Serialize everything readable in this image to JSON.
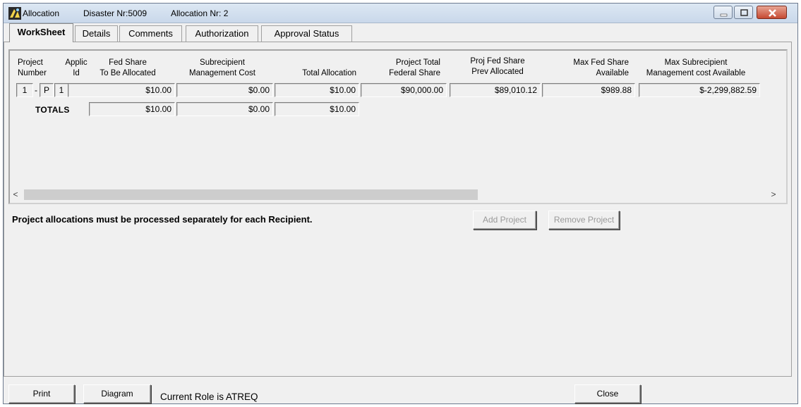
{
  "window": {
    "title_app": "Allocation",
    "title_disaster": "Disaster Nr:5009",
    "title_allocation": "Allocation Nr: 2"
  },
  "tabs": [
    {
      "label": "WorkSheet",
      "active": true
    },
    {
      "label": "Details",
      "active": false
    },
    {
      "label": "Comments",
      "active": false
    },
    {
      "label": "Authorization",
      "active": false
    },
    {
      "label": "Approval Status",
      "active": false
    }
  ],
  "grid": {
    "headers": {
      "project_number": [
        "Project",
        "Number"
      ],
      "applic_id": [
        "Applic",
        "Id"
      ],
      "fed_share": [
        "Fed Share",
        "To Be Allocated"
      ],
      "subrecipient_mgmt": [
        "Subrecipient",
        "Management Cost"
      ],
      "total_allocation": "Total Allocation",
      "project_total_fed": [
        "Project Total",
        "Federal Share"
      ],
      "proj_fed_prev": [
        "Proj Fed Share",
        "Prev Allocated"
      ],
      "max_fed_available": [
        "Max Fed Share",
        "Available"
      ],
      "max_subrecipient": [
        "Max Subrecipient",
        "Management cost Available"
      ]
    },
    "row": {
      "project_number": "1",
      "separator": "-",
      "applic_prefix": "P",
      "applic_id": "1",
      "fed_share": "$10.00",
      "subrecipient_mgmt": "$0.00",
      "total_allocation": "$10.00",
      "project_total_fed": "$90,000.00",
      "proj_fed_prev": "$89,010.12",
      "max_fed_available": "$989.88",
      "max_subrecipient": "$-2,299,882.59"
    },
    "totals": {
      "label": "TOTALS",
      "fed_share": "$10.00",
      "subrecipient_mgmt": "$0.00",
      "total_allocation": "$10.00"
    },
    "scroll_left": "<",
    "scroll_right": ">"
  },
  "notice": "Project allocations must be processed separately for each Recipient.",
  "buttons": {
    "add_project": "Add Project",
    "remove_project": "Remove Project",
    "print": "Print",
    "diagram": "Diagram",
    "close": "Close"
  },
  "status": {
    "role_text": "Current Role is ATREQ"
  }
}
